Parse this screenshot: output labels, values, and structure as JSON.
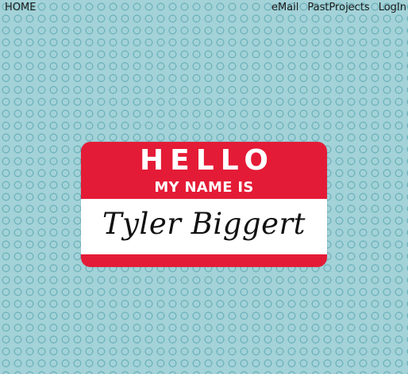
{
  "nav": {
    "home": "HOME",
    "email": "eMail",
    "past_projects": "PastProjects",
    "login": "LogIn"
  },
  "name_tag": {
    "greeting": "HELLO",
    "subtitle": "MY NAME IS",
    "name": "Tyler Biggert"
  },
  "colors": {
    "background": "#a3d2d8",
    "tag_red": "#e41b36"
  }
}
